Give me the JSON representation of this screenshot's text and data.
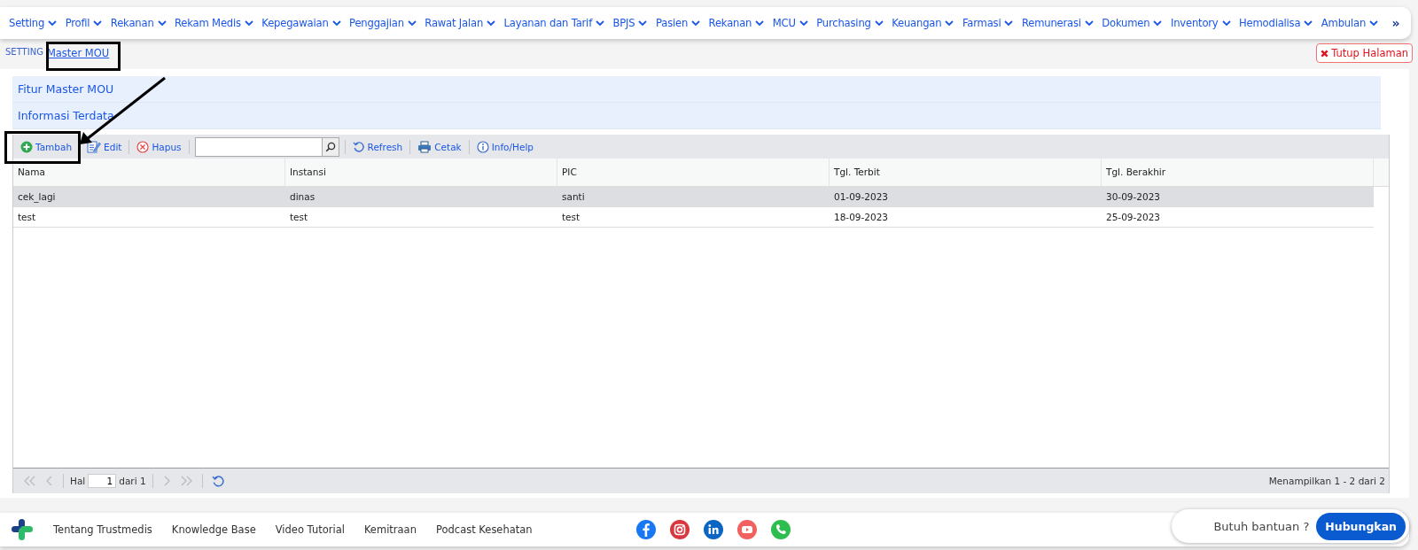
{
  "nav": {
    "items": [
      {
        "label": "Setting"
      },
      {
        "label": "Profil"
      },
      {
        "label": "Rekanan"
      },
      {
        "label": "Rekam Medis"
      },
      {
        "label": "Kepegawaian"
      },
      {
        "label": "Penggajian"
      },
      {
        "label": "Rawat Jalan"
      },
      {
        "label": "Layanan dan Tarif"
      },
      {
        "label": "BPJS"
      },
      {
        "label": "Pasien"
      },
      {
        "label": "Rekanan"
      },
      {
        "label": "MCU"
      },
      {
        "label": "Purchasing"
      },
      {
        "label": "Keuangan"
      },
      {
        "label": "Farmasi"
      },
      {
        "label": "Remunerasi"
      },
      {
        "label": "Dokumen"
      },
      {
        "label": "Inventory"
      },
      {
        "label": "Hemodialisa"
      },
      {
        "label": "Ambulan"
      }
    ],
    "more": "»"
  },
  "breadcrumb": {
    "root": "SETTING",
    "current": "Master MOU"
  },
  "close_button": "Tutup Halaman",
  "sections": [
    "Fitur Master MOU",
    "Informasi Terdata"
  ],
  "toolbar": [
    {
      "kind": "add",
      "label": "Tambah"
    },
    {
      "kind": "edit",
      "label": "Edit"
    },
    {
      "kind": "delete",
      "label": "Hapus"
    },
    {
      "kind": "search"
    },
    {
      "kind": "refresh",
      "label": "Refresh"
    },
    {
      "kind": "print",
      "label": "Cetak"
    },
    {
      "kind": "info",
      "label": "Info/Help"
    }
  ],
  "table": {
    "columns": [
      "Nama",
      "Instansi",
      "PIC",
      "Tgl. Terbit",
      "Tgl. Berakhir"
    ],
    "rows": [
      {
        "cells": [
          "cek_lagi",
          "dinas",
          "santi",
          "01-09-2023",
          "30-09-2023"
        ],
        "selected": true
      },
      {
        "cells": [
          "test",
          "test",
          "test",
          "18-09-2023",
          "25-09-2023"
        ],
        "selected": false
      }
    ]
  },
  "pager": {
    "page_label": "Hal",
    "page": "1",
    "of": "dari 1",
    "summary": "Menampilkan 1 - 2 dari 2"
  },
  "footer": {
    "links": [
      "Tentang Trustmedis",
      "Knowledge Base",
      "Video Tutorial",
      "Kemitraan",
      "Podcast Kesehatan"
    ],
    "help_text": "Butuh bantuan ?",
    "help_button": "Hubungkan"
  }
}
